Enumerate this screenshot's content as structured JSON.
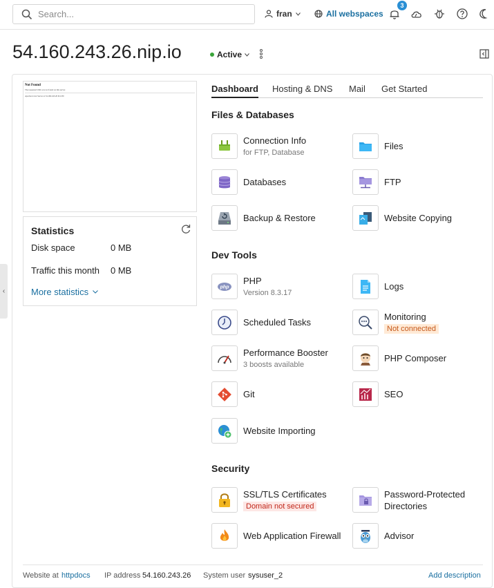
{
  "topbar": {
    "search_placeholder": "Search...",
    "user_name": "fran",
    "workspace_label": "All webspaces",
    "notification_count": "3"
  },
  "header": {
    "domain": "54.160.243.26.nip.io",
    "status": "Active"
  },
  "preview": {
    "title": "Not Found",
    "line1": "The requested URL was not found on this server.",
    "line2": "Apache/2.4.xx Server at 54.160.243.26 Port 80"
  },
  "statistics": {
    "title": "Statistics",
    "disk_label": "Disk space",
    "disk_value": "0 MB",
    "traffic_label": "Traffic this month",
    "traffic_value": "0 MB",
    "more_label": "More statistics"
  },
  "tabs": [
    "Dashboard",
    "Hosting & DNS",
    "Mail",
    "Get Started"
  ],
  "sections": {
    "files": "Files & Databases",
    "dev": "Dev Tools",
    "security": "Security"
  },
  "tiles": {
    "connection": {
      "name": "Connection Info",
      "sub": "for FTP, Database"
    },
    "files": {
      "name": "Files"
    },
    "databases": {
      "name": "Databases"
    },
    "ftp": {
      "name": "FTP"
    },
    "backup": {
      "name": "Backup & Restore"
    },
    "copying": {
      "name": "Website Copying"
    },
    "php": {
      "name": "PHP",
      "sub": "Version 8.3.17"
    },
    "logs": {
      "name": "Logs"
    },
    "scheduled": {
      "name": "Scheduled Tasks"
    },
    "monitoring": {
      "name": "Monitoring",
      "tag": "Not connected"
    },
    "booster": {
      "name": "Performance Booster",
      "sub": "3 boosts available"
    },
    "composer": {
      "name": "PHP Composer"
    },
    "git": {
      "name": "Git"
    },
    "seo": {
      "name": "SEO"
    },
    "importing": {
      "name": "Website Importing"
    },
    "ssl": {
      "name": "SSL/TLS Certificates",
      "tag": "Domain not secured"
    },
    "password": {
      "name": "Password-Protected Directories"
    },
    "firewall": {
      "name": "Web Application Firewall"
    },
    "advisor": {
      "name": "Advisor"
    }
  },
  "footer": {
    "website_at_label": "Website at",
    "website_at_value": "httpdocs",
    "ip_label": "IP address",
    "ip_value": "54.160.243.26",
    "sysuser_label": "System user",
    "sysuser_value": "sysuser_2",
    "add_description": "Add description"
  },
  "colors": {
    "accent": "#1a6fa0",
    "active_dot": "#3aa53a",
    "badge": "#2a8fd4",
    "warning_red": "#c0271a",
    "warning_orange": "#c5581a"
  }
}
